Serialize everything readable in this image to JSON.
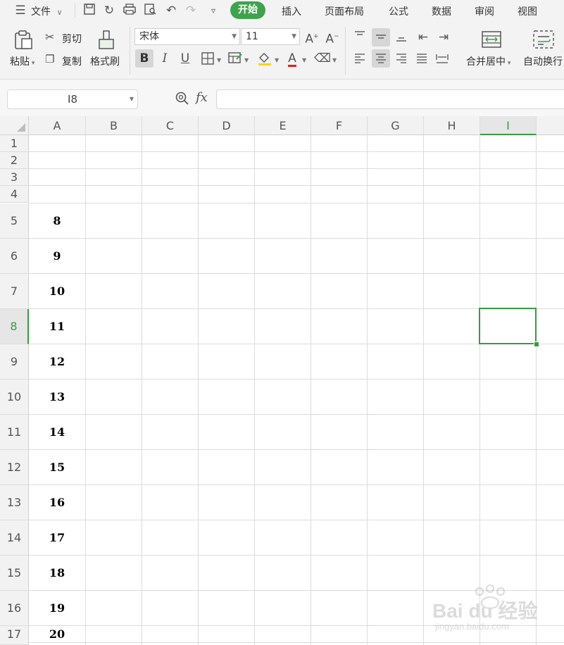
{
  "menubar": {
    "file_label": "文件",
    "tabs": [
      {
        "label": "开始",
        "active": true
      },
      {
        "label": "插入"
      },
      {
        "label": "页面布局"
      },
      {
        "label": "公式"
      },
      {
        "label": "数据"
      },
      {
        "label": "审阅"
      },
      {
        "label": "视图"
      }
    ]
  },
  "ribbon": {
    "paste_label": "粘贴",
    "cut_label": "剪切",
    "copy_label": "复制",
    "format_painter_label": "格式刷",
    "font_name": "宋体",
    "font_size": "11",
    "bold_label": "B",
    "italic_label": "I",
    "underline_label": "U",
    "font_color_label": "A",
    "merge_center_label": "合并居中",
    "wrap_text_label": "自动换行"
  },
  "formula_bar": {
    "name_box": "I8",
    "fx_label": "fx",
    "formula": ""
  },
  "grid": {
    "columns": [
      "A",
      "B",
      "C",
      "D",
      "E",
      "F",
      "G",
      "H",
      "I"
    ],
    "active_column": "I",
    "active_row": "8",
    "rows": [
      {
        "label": "1",
        "value": ""
      },
      {
        "label": "2",
        "value": ""
      },
      {
        "label": "3",
        "value": ""
      },
      {
        "label": "4",
        "value": ""
      },
      {
        "label": "5",
        "value": "8"
      },
      {
        "label": "6",
        "value": "9"
      },
      {
        "label": "7",
        "value": "10"
      },
      {
        "label": "8",
        "value": "11"
      },
      {
        "label": "9",
        "value": "12"
      },
      {
        "label": "10",
        "value": "13"
      },
      {
        "label": "11",
        "value": "14"
      },
      {
        "label": "12",
        "value": "15"
      },
      {
        "label": "13",
        "value": "16"
      },
      {
        "label": "14",
        "value": "17"
      },
      {
        "label": "15",
        "value": "18"
      },
      {
        "label": "16",
        "value": "19"
      },
      {
        "label": "17",
        "value": "20"
      }
    ]
  },
  "watermark": {
    "brand": "Bai du 经验",
    "url": "jingyan.baidu.com"
  },
  "colors": {
    "accent_green": "#3fa34d",
    "selection_green": "#3a9a44",
    "font_color_red": "#e02020",
    "highlight_yellow": "#f5d800"
  }
}
